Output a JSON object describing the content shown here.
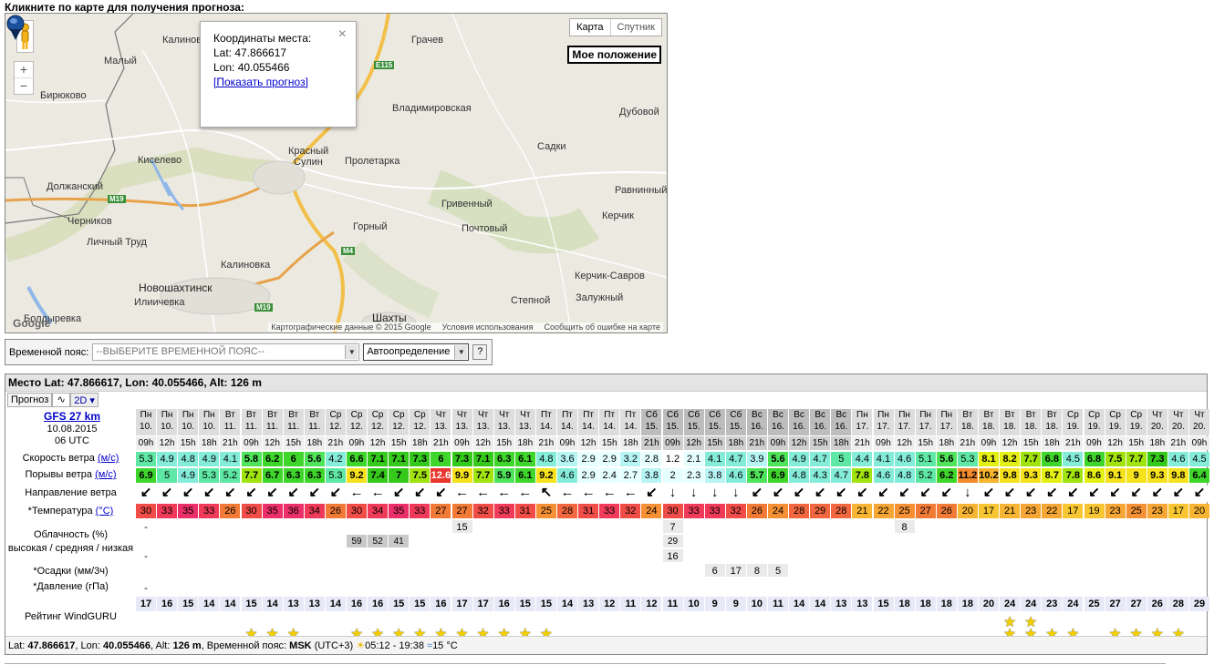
{
  "hint": "Кликните по карте для получения прогноза:",
  "map": {
    "type_map": "Карта",
    "type_sat": "Спутник",
    "my_position": "Мое положение",
    "popup": {
      "title": "Координаты места:",
      "lat": "Lat: 47.866617",
      "lon": "Lon: 40.055466",
      "link": "[Показать прогноз]"
    },
    "footer": [
      "Картографические данные © 2015 Google",
      "Условия использования",
      "Сообщить об ошибке на карте"
    ],
    "logo": "Google",
    "cities": [
      {
        "name": "Калинов"
      },
      {
        "name": "Грачев"
      },
      {
        "name": "Малый"
      },
      {
        "name": "Бирюково"
      },
      {
        "name": "Владимировская"
      },
      {
        "name": "Дубовой"
      },
      {
        "name": "Красный"
      },
      {
        "name": "Сулин"
      },
      {
        "name": "Садки"
      },
      {
        "name": "Киселево"
      },
      {
        "name": "Пролетарка"
      },
      {
        "name": "Должанский"
      },
      {
        "name": "Гривенный"
      },
      {
        "name": "Равнинный"
      },
      {
        "name": "Черников"
      },
      {
        "name": "Почтовый"
      },
      {
        "name": "Керчик"
      },
      {
        "name": "Горный"
      },
      {
        "name": "Личный Труд"
      },
      {
        "name": "Калиновка"
      },
      {
        "name": "Керчик-Савров"
      },
      {
        "name": "Новошахтинск"
      },
      {
        "name": "Илиичевка"
      },
      {
        "name": "Степной"
      },
      {
        "name": "Залужный"
      },
      {
        "name": "Болдыревка"
      },
      {
        "name": "Шахты"
      }
    ],
    "roads": [
      "E115",
      "M19",
      "M4",
      "M19"
    ]
  },
  "timezone": {
    "label": "Временной пояс:",
    "placeholder": "--ВЫБЕРИТЕ ВРЕМЕННОЙ ПОЯС--",
    "auto": "Автоопределение",
    "help": "?"
  },
  "forecast": {
    "title": "Место Lat: 47.866617, Lon: 40.055466, Alt: 126 m",
    "tab": "Прогноз",
    "mode": "2D",
    "model": "GFS 27 km",
    "date": "10.08.2015",
    "utc": "06 UTC",
    "labels": {
      "wind": "Скорость ветра",
      "wind_unit": "(м/с)",
      "gust": "Порывы ветра",
      "gust_unit": "(м/с)",
      "dir": "Направление ветра",
      "temp": "*Температура",
      "temp_unit": "(°C)",
      "cloud1": "Облачность (%)",
      "cloud2": "высокая / средняя / низкая",
      "precip": "*Осадки (мм/3ч)",
      "press": "*Давление (гПа)",
      "rating": "Рейтинг WindGURU"
    },
    "days": [
      "Пн",
      "Пн",
      "Пн",
      "Пн",
      "Вт",
      "Вт",
      "Вт",
      "Вт",
      "Вт",
      "Ср",
      "Ср",
      "Ср",
      "Ср",
      "Ср",
      "Чт",
      "Чт",
      "Чт",
      "Чт",
      "Чт",
      "Пт",
      "Пт",
      "Пт",
      "Пт",
      "Пт",
      "Сб",
      "Сб",
      "Сб",
      "Сб",
      "Сб",
      "Вс",
      "Вс",
      "Вс",
      "Вс",
      "Вс",
      "Пн",
      "Пн",
      "Пн",
      "Пн",
      "Пн",
      "Вт",
      "Вт",
      "Вт",
      "Вт",
      "Вт",
      "Ср",
      "Ср",
      "Ср",
      "Ср",
      "Чт",
      "Чт"
    ],
    "dates": [
      "10.",
      "10.",
      "10.",
      "10.",
      "11.",
      "11.",
      "11.",
      "11.",
      "11.",
      "12.",
      "12.",
      "12.",
      "12.",
      "12.",
      "13.",
      "13.",
      "13.",
      "13.",
      "13.",
      "14.",
      "14.",
      "14.",
      "14.",
      "14.",
      "15.",
      "15.",
      "15.",
      "15.",
      "15.",
      "16.",
      "16.",
      "16.",
      "16.",
      "16.",
      "17.",
      "17.",
      "17.",
      "17.",
      "17.",
      "18.",
      "18.",
      "18.",
      "18.",
      "18.",
      "19.",
      "19.",
      "19.",
      "19.",
      "20.",
      "20."
    ],
    "hours": [
      "09h",
      "12h",
      "15h",
      "18h",
      "21h",
      "09h",
      "12h",
      "15h",
      "18h",
      "21h",
      "09h",
      "12h",
      "15h",
      "18h",
      "21h",
      "09h",
      "12h",
      "15h",
      "18h",
      "21h",
      "09h",
      "12h",
      "15h",
      "18h",
      "21h",
      "09h",
      "12h",
      "15h",
      "18h",
      "21h",
      "09h",
      "12h",
      "15h",
      "18h",
      "21h",
      "09h",
      "12h",
      "15h",
      "18h",
      "21h",
      "09h",
      "12h",
      "15h",
      "18h",
      "21h",
      "09h",
      "12h",
      "15h",
      "18h",
      "21h",
      "09h"
    ],
    "wind": [
      "5.3",
      "4.9",
      "4.8",
      "4.9",
      "4.1",
      "5.8",
      "6.2",
      "6",
      "5.6",
      "4.2",
      "6.6",
      "7.1",
      "7.1",
      "7.3",
      "6",
      "7.3",
      "7.1",
      "6.3",
      "6.1",
      "4.8",
      "3.6",
      "2.9",
      "2.9",
      "3.2",
      "2.8",
      "1.2",
      "2.1",
      "4.1",
      "4.7",
      "3.9",
      "5.6",
      "4.9",
      "4.7",
      "5",
      "4.4",
      "4.1",
      "4.6",
      "5.1",
      "5.6",
      "5.3",
      "8.1",
      "8.2",
      "7.7",
      "6.8",
      "4.5",
      "6.8",
      "7.5",
      "7.7",
      "7.3",
      "4.6",
      "4.5"
    ],
    "gust": [
      "6.9",
      "5",
      "4.9",
      "5.3",
      "5.2",
      "7.7",
      "6.7",
      "6.3",
      "6.3",
      "5.3",
      "9.2",
      "7.4",
      "7",
      "7.5",
      "12.6",
      "9.9",
      "7.7",
      "5.9",
      "6.1",
      "9.2",
      "4.6",
      "2.9",
      "2.4",
      "2.7",
      "3.8",
      "2",
      "2.3",
      "3.8",
      "4.6",
      "5.7",
      "6.9",
      "4.8",
      "4.3",
      "4.7",
      "7.8",
      "4.6",
      "4.8",
      "5.2",
      "6.2",
      "11.2",
      "10.2",
      "9.8",
      "9.3",
      "8.7",
      "7.8",
      "8.6",
      "9.1",
      "9",
      "9.3",
      "9.8",
      "6.4"
    ],
    "dir": [
      "↙",
      "↙",
      "↙",
      "↙",
      "↙",
      "↙",
      "↙",
      "↙",
      "↙",
      "↙",
      "←",
      "←",
      "↙",
      "↙",
      "↙",
      "←",
      "←",
      "←",
      "←",
      "↖",
      "←",
      "←",
      "←",
      "←",
      "↙",
      "↓",
      "↓",
      "↓",
      "↓",
      "↙",
      "↙",
      "↙",
      "↙",
      "↙",
      "↙",
      "↙",
      "↙",
      "↙",
      "↙",
      "↓",
      "↙",
      "↙",
      "↙",
      "↙",
      "↙",
      "↙",
      "↙",
      "↙",
      "↙",
      "↙",
      "↙"
    ],
    "temp": [
      "30",
      "33",
      "35",
      "33",
      "26",
      "30",
      "35",
      "36",
      "34",
      "26",
      "30",
      "34",
      "35",
      "33",
      "27",
      "27",
      "32",
      "33",
      "31",
      "25",
      "28",
      "31",
      "33",
      "32",
      "24",
      "30",
      "33",
      "33",
      "32",
      "26",
      "24",
      "28",
      "29",
      "28",
      "21",
      "22",
      "25",
      "27",
      "26",
      "20",
      "17",
      "21",
      "23",
      "22",
      "17",
      "19",
      "23",
      "25",
      "23",
      "17",
      "20"
    ],
    "clouds_high": [
      "-",
      "",
      "",
      "",
      "",
      "",
      "",
      "",
      "",
      "",
      "",
      "",
      "",
      "",
      "",
      "15",
      "",
      "",
      "",
      "",
      "",
      "",
      "",
      "",
      "",
      "7",
      "",
      "",
      "",
      "",
      "",
      "",
      "",
      "",
      "",
      "",
      "8",
      "",
      "",
      "",
      "",
      "",
      "",
      "",
      "",
      "",
      "",
      "",
      "",
      "",
      ""
    ],
    "clouds_mid": [
      "",
      "",
      "",
      "",
      "",
      "",
      "",
      "",
      "",
      "",
      "59",
      "52",
      "41",
      "",
      "",
      "",
      "",
      "",
      "",
      "",
      "",
      "",
      "",
      "",
      "",
      "29",
      "",
      "",
      "",
      "",
      "",
      "",
      "",
      "",
      "",
      "",
      "",
      "",
      "",
      "",
      "",
      "",
      "",
      "",
      "",
      "",
      "",
      "",
      "",
      "",
      ""
    ],
    "clouds_low": [
      "-",
      "",
      "",
      "",
      "",
      "",
      "",
      "",
      "",
      "",
      "",
      "",
      "",
      "",
      "",
      "",
      "",
      "",
      "",
      "",
      "",
      "",
      "",
      "",
      "",
      "16",
      "",
      "",
      "",
      "",
      "",
      "",
      "",
      "",
      "",
      "",
      "",
      "",
      "",
      "",
      "",
      "",
      "",
      "",
      "",
      "",
      "",
      "",
      "",
      "",
      ""
    ],
    "clouds_low2": [
      "",
      "",
      "",
      "",
      "",
      "",
      "",
      "",
      "",
      "",
      "",
      "",
      "",
      "",
      "",
      "",
      "",
      "",
      "",
      "",
      "",
      "",
      "",
      "",
      "",
      "",
      "",
      "6",
      "17",
      "8",
      "5",
      "",
      "",
      "",
      "",
      "",
      "",
      "",
      "",
      "",
      "",
      "",
      "",
      "",
      "",
      "",
      "",
      "",
      "",
      "",
      ""
    ],
    "precip": [
      "-",
      "",
      "",
      "",
      "",
      "",
      "",
      "",
      "",
      "",
      "",
      "",
      "",
      "",
      "",
      "",
      "",
      "",
      "",
      "",
      "",
      "",
      "",
      "",
      "",
      "",
      "",
      "",
      "",
      "",
      "",
      "",
      "",
      "",
      "",
      "",
      "",
      "",
      "",
      "",
      "",
      "",
      "",
      "",
      "",
      "",
      "",
      "",
      "",
      "",
      ""
    ],
    "press": [
      "17",
      "16",
      "15",
      "14",
      "14",
      "15",
      "14",
      "13",
      "13",
      "14",
      "16",
      "16",
      "15",
      "15",
      "16",
      "17",
      "17",
      "16",
      "15",
      "15",
      "14",
      "13",
      "12",
      "11",
      "12",
      "11",
      "10",
      "9",
      "9",
      "10",
      "11",
      "14",
      "14",
      "13",
      "13",
      "15",
      "18",
      "18",
      "18",
      "18",
      "20",
      "24",
      "24",
      "23",
      "24",
      "25",
      "27",
      "27",
      "26",
      "28",
      "29"
    ],
    "rating": [
      0,
      0,
      0,
      0,
      0,
      1,
      1,
      1,
      0,
      0,
      1,
      1,
      1,
      1,
      1,
      1,
      1,
      1,
      1,
      1,
      0,
      0,
      0,
      0,
      0,
      0,
      0,
      0,
      0,
      0,
      0,
      0,
      0,
      0,
      0,
      0,
      0,
      0,
      0,
      0,
      0,
      2,
      2,
      1,
      1,
      0,
      1,
      1,
      1,
      1,
      0
    ],
    "footer": {
      "lat_label": "Lat:",
      "lat": "47.866617",
      "lon_label": ", Lon:",
      "lon": "40.055466",
      "alt_label": ", Alt:",
      "alt": "126 m",
      "tz_label": ", Временной пояс:",
      "tz": "MSK",
      "utc": "(UTC+3)",
      "sun": "05:12 - 19:38",
      "water": "15 °C"
    }
  }
}
